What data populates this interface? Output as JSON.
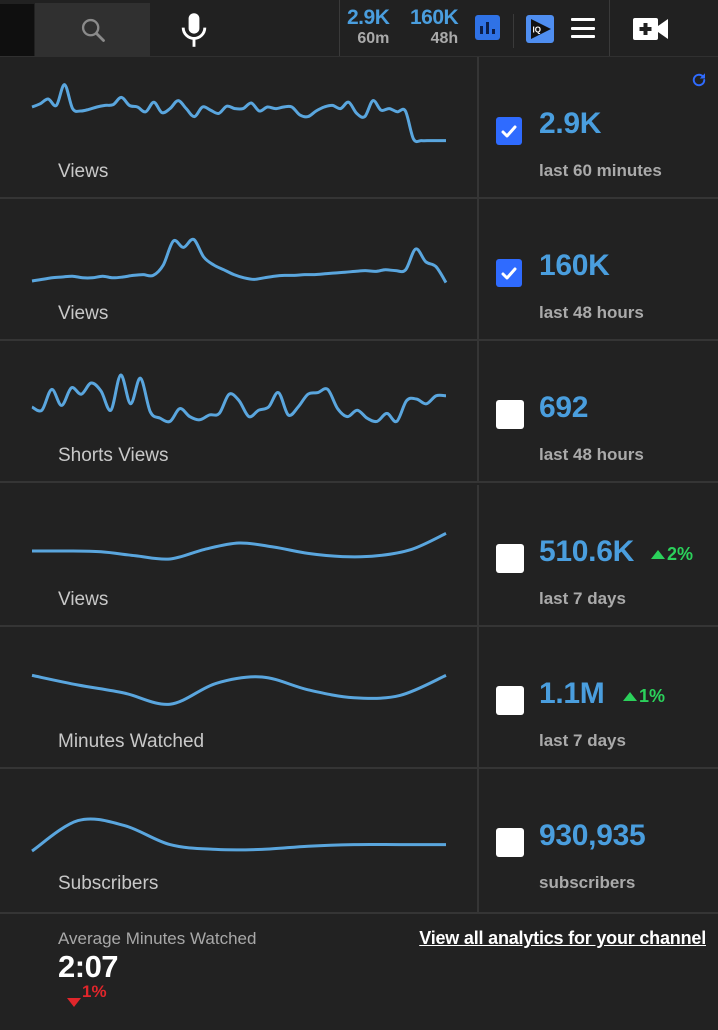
{
  "topbar": {
    "stats": [
      {
        "value": "2.9K",
        "label": "60m"
      },
      {
        "value": "160K",
        "label": "48h"
      }
    ],
    "icons": [
      "search-icon",
      "microphone-icon",
      "analytics-chart-icon",
      "vidiq-logo-icon",
      "menu-icon",
      "create-video-icon"
    ],
    "iq_label": "IQ"
  },
  "colors": {
    "accent_blue": "#4a9ede",
    "line_blue": "#5aa6de",
    "checkbox_blue": "#2f6bff",
    "positive_green": "#2bd15b",
    "negative_red": "#e0262b"
  },
  "metrics": [
    {
      "label": "Views",
      "value": "2.9K",
      "period": "last 60 minutes",
      "checked": true,
      "change": null
    },
    {
      "label": "Views",
      "value": "160K",
      "period": "last 48 hours",
      "checked": true,
      "change": null
    },
    {
      "label": "Shorts Views",
      "value": "692",
      "period": "last 48 hours",
      "checked": false,
      "change": null
    },
    {
      "label": "Views",
      "value": "510.6K",
      "period": "last 7 days",
      "checked": false,
      "change": "2%",
      "change_direction": "up"
    },
    {
      "label": "Minutes Watched",
      "value": "1.1M",
      "period": "last 7 days",
      "checked": false,
      "change": "1%",
      "change_direction": "up"
    },
    {
      "label": "Subscribers",
      "value": "930,935",
      "period": "subscribers",
      "checked": false,
      "change": null
    }
  ],
  "chart_data": [
    {
      "type": "line",
      "title": "Views (last 60 minutes)",
      "values": [
        60,
        64,
        70,
        62,
        88,
        58,
        55,
        57,
        60,
        62,
        63,
        72,
        62,
        60,
        54,
        66,
        53,
        58,
        68,
        58,
        48,
        60,
        56,
        52,
        61,
        58,
        58,
        65,
        55,
        60,
        58,
        60,
        60,
        50,
        48,
        55,
        60,
        62,
        58,
        66,
        52,
        48,
        68,
        56,
        58,
        54,
        55,
        20,
        18,
        18,
        18,
        18
      ]
    },
    {
      "type": "line",
      "title": "Views (last 48 hours)",
      "values": [
        20,
        22,
        24,
        25,
        26,
        24,
        24,
        26,
        24,
        25,
        27,
        28,
        27,
        40,
        70,
        62,
        72,
        50,
        40,
        34,
        28,
        24,
        22,
        24,
        26,
        27,
        27,
        28,
        28,
        29,
        30,
        31,
        32,
        33,
        32,
        34,
        33,
        34,
        60,
        44,
        38,
        18
      ]
    },
    {
      "type": "line",
      "title": "Shorts Views (last 48 hours)",
      "values": [
        40,
        36,
        62,
        42,
        64,
        56,
        70,
        60,
        36,
        80,
        44,
        76,
        34,
        26,
        22,
        38,
        28,
        24,
        30,
        32,
        56,
        48,
        28,
        36,
        40,
        58,
        30,
        40,
        56,
        58,
        62,
        38,
        28,
        36,
        26,
        22,
        32,
        22,
        48,
        50,
        44,
        54,
        54
      ]
    },
    {
      "type": "line",
      "title": "Views (last 7 days)",
      "values": [
        40,
        40,
        39,
        34,
        30,
        42,
        50,
        45,
        37,
        33,
        34,
        42,
        62
      ]
    },
    {
      "type": "line",
      "title": "Minutes Watched (last 7 days)",
      "values": [
        62,
        50,
        40,
        26,
        52,
        60,
        44,
        34,
        37,
        62
      ]
    },
    {
      "type": "line",
      "title": "Subscribers",
      "values": [
        20,
        58,
        52,
        28,
        22,
        22,
        26,
        28,
        28,
        28
      ]
    }
  ],
  "footer": {
    "label": "Average Minutes Watched",
    "value": "2:07",
    "change": "1%",
    "change_direction": "down",
    "link": "View all analytics for your channel"
  }
}
